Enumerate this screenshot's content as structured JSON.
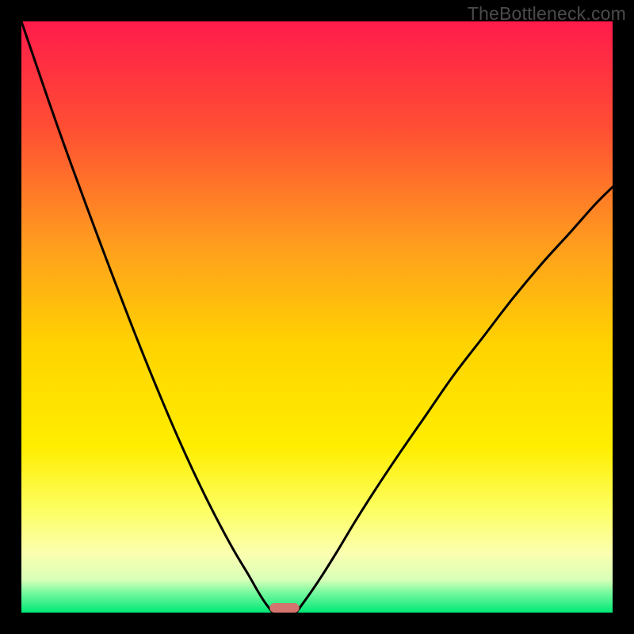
{
  "watermark": "TheBottleneck.com",
  "chart_data": {
    "type": "line",
    "title": "",
    "xlabel": "",
    "ylabel": "",
    "xlim": [
      0,
      100
    ],
    "ylim": [
      0,
      100
    ],
    "grid": false,
    "legend": false,
    "background_gradient": {
      "stops": [
        {
          "offset": 0.0,
          "color": "#ff1b4b"
        },
        {
          "offset": 0.18,
          "color": "#ff4e33"
        },
        {
          "offset": 0.38,
          "color": "#ff9e1e"
        },
        {
          "offset": 0.55,
          "color": "#ffd400"
        },
        {
          "offset": 0.72,
          "color": "#ffee00"
        },
        {
          "offset": 0.83,
          "color": "#fdff66"
        },
        {
          "offset": 0.9,
          "color": "#fbffb0"
        },
        {
          "offset": 0.945,
          "color": "#d8ffb8"
        },
        {
          "offset": 0.965,
          "color": "#7cf9a0"
        },
        {
          "offset": 1.0,
          "color": "#00e876"
        }
      ]
    },
    "series": [
      {
        "name": "left-curve",
        "x": [
          0.0,
          2.4,
          4.8,
          7.2,
          9.6,
          12.0,
          14.4,
          16.8,
          19.2,
          21.6,
          24.0,
          26.4,
          28.8,
          31.2,
          33.6,
          36.0,
          38.4,
          40.0,
          41.0,
          41.8,
          42.5
        ],
        "y": [
          100.0,
          93.0,
          86.0,
          79.2,
          72.6,
          66.1,
          59.7,
          53.4,
          47.2,
          41.2,
          35.4,
          29.8,
          24.5,
          19.5,
          14.8,
          10.4,
          6.4,
          3.6,
          2.0,
          0.9,
          0.0
        ]
      },
      {
        "name": "right-curve",
        "x": [
          46.5,
          47.5,
          49.0,
          51.0,
          53.5,
          56.5,
          60.0,
          64.0,
          68.5,
          73.0,
          78.0,
          83.0,
          88.0,
          93.0,
          97.0,
          100.0
        ],
        "y": [
          0.0,
          1.4,
          3.5,
          6.5,
          10.5,
          15.5,
          21.0,
          27.0,
          33.5,
          40.0,
          46.5,
          53.0,
          59.0,
          64.5,
          69.0,
          72.0
        ]
      }
    ],
    "minimum_marker": {
      "x_center": 44.5,
      "width": 5.0,
      "color": "#d4746f"
    }
  }
}
